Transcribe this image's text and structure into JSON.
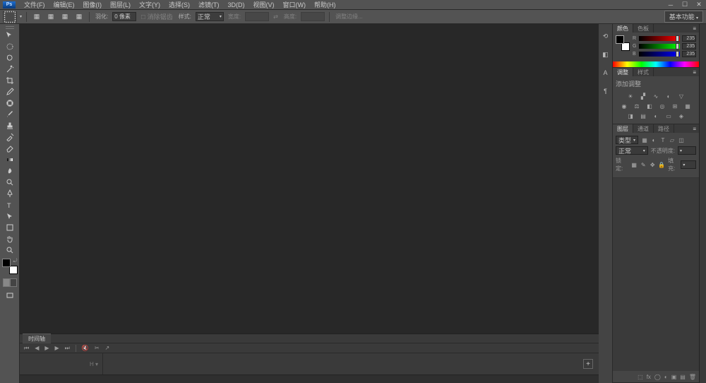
{
  "menu": {
    "items": [
      "文件(F)",
      "编辑(E)",
      "图像(I)",
      "图层(L)",
      "文字(Y)",
      "选择(S)",
      "滤镜(T)",
      "3D(D)",
      "视图(V)",
      "窗口(W)",
      "帮助(H)"
    ]
  },
  "options": {
    "feather_label": "羽化:",
    "feather_value": "0 像素",
    "style_label": "样式:",
    "style_value": "正常",
    "width_label": "宽度:",
    "height_label": "高度:",
    "refine_label": "调整边缘...",
    "workspace": "基本功能",
    "antialias": "消除锯齿"
  },
  "color": {
    "tab1": "颜色",
    "tab2": "色板",
    "r_label": "R",
    "g_label": "G",
    "b_label": "B",
    "r": "235",
    "g": "235",
    "b": "235"
  },
  "adjust": {
    "tab1": "调整",
    "tab2": "样式",
    "label": "添加调整"
  },
  "layers": {
    "tab1": "图层",
    "tab2": "通道",
    "tab3": "路径",
    "kind_label": "类型",
    "mode_value": "正常",
    "opacity_label": "不透明度:",
    "lock_label": "锁定:",
    "fill_label": "填充:"
  },
  "timeline": {
    "tab": "时间轴",
    "fps_label": "H ▾"
  }
}
